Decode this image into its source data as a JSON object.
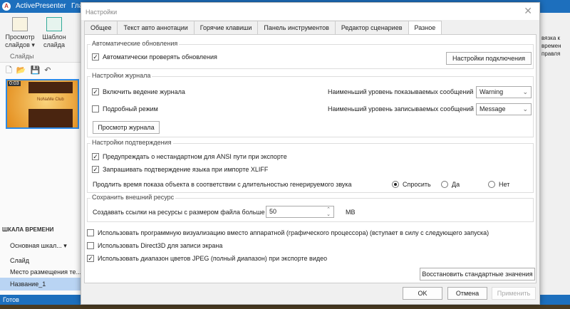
{
  "app": {
    "title": "ActivePresenter",
    "menu_partial": "Гла",
    "status": "Готов"
  },
  "ribbon": {
    "slides_view": "Просмотр слайдов ▾",
    "slide_template": "Шаблон слайда",
    "group_slides": "Слайды",
    "right_partial": [
      "вязка к",
      "времен",
      "правля"
    ]
  },
  "slide_thumb": {
    "time": "0:03",
    "title": "NoNaMe Club"
  },
  "timeline": {
    "header": "ШКАЛА ВРЕМЕНИ",
    "main_timeline": "Основная шкал...",
    "items": [
      "Слайд",
      "Место размещения те...",
      "Название_1"
    ]
  },
  "dialog": {
    "title": "Настройки",
    "tabs": [
      "Общее",
      "Текст авто аннотации",
      "Горячие клавиши",
      "Панель инструментов",
      "Редактор сценариев",
      "Разное"
    ],
    "active_tab": "Разное",
    "updates": {
      "legend": "Автоматические обновления",
      "auto_check": "Автоматически проверять обновления",
      "auto_check_checked": true,
      "connection_button": "Настройки подключения"
    },
    "journal": {
      "legend": "Настройки журнала",
      "enable": "Включить ведение журнала",
      "enable_checked": true,
      "verbose": "Подробный режим",
      "verbose_checked": false,
      "view_button": "Просмотр журнала",
      "min_show_label": "Наименьший уровень показываемых сообщений",
      "min_show_value": "Warning",
      "min_write_label": "Наименьший уровень записываемых сообщений",
      "min_write_value": "Message"
    },
    "confirm": {
      "legend": "Настройки подтверждения",
      "ansi": "Предупреждать о нестандартном для ANSI пути при экспорте",
      "ansi_checked": true,
      "xliff": "Запрашивать подтверждение языка при импорте XLIFF",
      "xliff_checked": true,
      "extend_label": "Продлить время показа объекта в соответствии с длительностью генерируемого звука",
      "options": [
        "Спросить",
        "Да",
        "Нет"
      ],
      "selected": "Спросить"
    },
    "external": {
      "legend": "Сохранить внешний ресурс",
      "label": "Создавать ссылки на ресурсы с размером файла больше",
      "value": "50",
      "unit": "MB"
    },
    "software_render": "Использовать программную визуализацию вместо аппаратной (графического процессора) (вступает в силу с следующего запуска)",
    "software_render_checked": false,
    "direct3d": "Использовать Direct3D для записи экрана",
    "direct3d_checked": false,
    "jpeg_range": "Использовать диапазон цветов JPEG (полный диапазон) при экспорте видео",
    "jpeg_range_checked": true,
    "restore_button": "Восстановить стандартные значения",
    "ok": "OK",
    "cancel": "Отмена",
    "apply": "Применить"
  }
}
